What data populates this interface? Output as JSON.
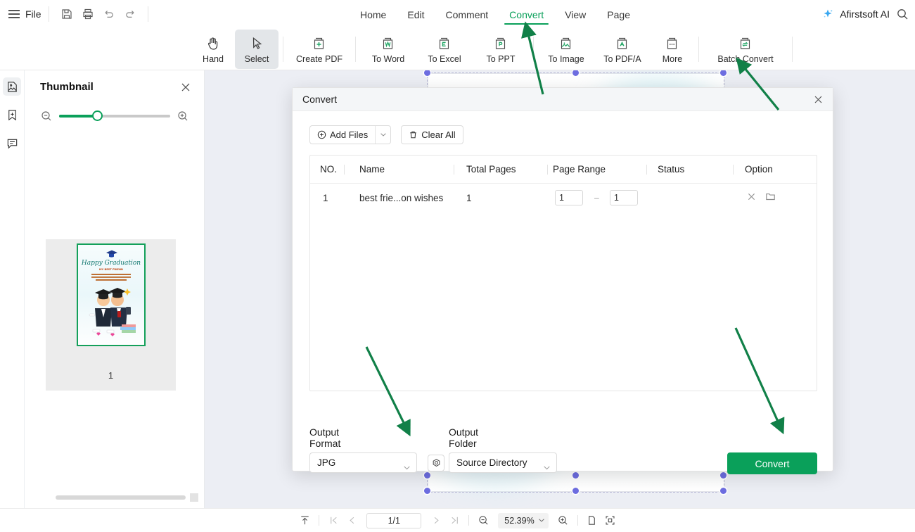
{
  "app": {
    "file_menu": "File",
    "brand": "Afirstsoft AI",
    "accent": "#0aa05a"
  },
  "quick_tools": [
    {
      "name": "save-icon"
    },
    {
      "name": "print-icon"
    },
    {
      "name": "undo-icon"
    },
    {
      "name": "redo-icon"
    }
  ],
  "menu": {
    "items": [
      {
        "label": "Home",
        "active": false
      },
      {
        "label": "Edit",
        "active": false
      },
      {
        "label": "Comment",
        "active": false
      },
      {
        "label": "Convert",
        "active": true
      },
      {
        "label": "View",
        "active": false
      },
      {
        "label": "Page",
        "active": false
      }
    ]
  },
  "ribbon": {
    "tools": [
      {
        "label": "Hand",
        "icon": "hand-icon",
        "selected": false
      },
      {
        "label": "Select",
        "icon": "cursor-icon",
        "selected": true
      }
    ],
    "actions": [
      {
        "label": "Create PDF",
        "icon": "create-pdf-icon"
      },
      {
        "label": "To Word",
        "icon": "to-word-icon"
      },
      {
        "label": "To Excel",
        "icon": "to-excel-icon"
      },
      {
        "label": "To PPT",
        "icon": "to-ppt-icon"
      },
      {
        "label": "To Image",
        "icon": "to-image-icon"
      },
      {
        "label": "To PDF/A",
        "icon": "to-pdfa-icon"
      },
      {
        "label": "More",
        "icon": "more-icon"
      }
    ],
    "batch": {
      "label": "Batch Convert",
      "icon": "batch-convert-icon"
    }
  },
  "rail": {
    "items": [
      {
        "name": "thumbnail-panel-icon",
        "active": true
      },
      {
        "name": "bookmark-icon",
        "active": false
      },
      {
        "name": "comment-icon",
        "active": false
      }
    ]
  },
  "thumbnail_panel": {
    "title": "Thumbnail",
    "close_icon": "close-icon",
    "zoom_out_icon": "zoom-out-icon",
    "zoom_in_icon": "zoom-in-icon",
    "slider_value": 30,
    "pages": [
      {
        "number": "1",
        "title": "Happy Graduation",
        "subtitle": "MY BEST FRIEND"
      }
    ]
  },
  "modal": {
    "title": "Convert",
    "close_icon": "close-icon",
    "add_files": {
      "label": "Add Files",
      "icon": "plus-circle-icon",
      "caret": "chevron-down-icon"
    },
    "clear_all": {
      "label": "Clear All",
      "icon": "trash-icon"
    },
    "table": {
      "headers": [
        "NO.",
        "Name",
        "Total Pages",
        "Page Range",
        "Status",
        "Option"
      ],
      "rows": [
        {
          "no": "1",
          "name": "best frie...on wishes",
          "total_pages": "1",
          "range_from": "1",
          "range_sep": "–",
          "range_to": "1",
          "status": "",
          "option_remove_icon": "close-icon",
          "option_folder_icon": "folder-icon"
        }
      ]
    },
    "output_format": {
      "label": "Output Format",
      "value": "JPG",
      "caret": "chevron-down-icon"
    },
    "settings_icon": "settings-gear-icon",
    "output_folder": {
      "label": "Output Folder",
      "value": "Source Directory",
      "caret": "chevron-down-icon"
    },
    "convert_button": "Convert"
  },
  "bottombar": {
    "fit_icon": "fit-page-icon",
    "first_icon": "first-page-icon",
    "prev_icon": "prev-page-icon",
    "page_value": "1/1",
    "next_icon": "next-page-icon",
    "last_icon": "last-page-icon",
    "zoom_out_icon": "zoom-out-icon",
    "zoom_value": "52.39%",
    "zoom_caret": "chevron-down-icon",
    "zoom_in_icon": "zoom-in-icon",
    "single_page_icon": "single-page-icon",
    "fullscreen_icon": "fullscreen-icon"
  },
  "annotations": {
    "arrow_color": "#118048",
    "arrows": [
      {
        "name": "arrow-to-convert-tab"
      },
      {
        "name": "arrow-to-batch-convert"
      },
      {
        "name": "arrow-to-output-format"
      },
      {
        "name": "arrow-to-convert-button"
      }
    ]
  }
}
